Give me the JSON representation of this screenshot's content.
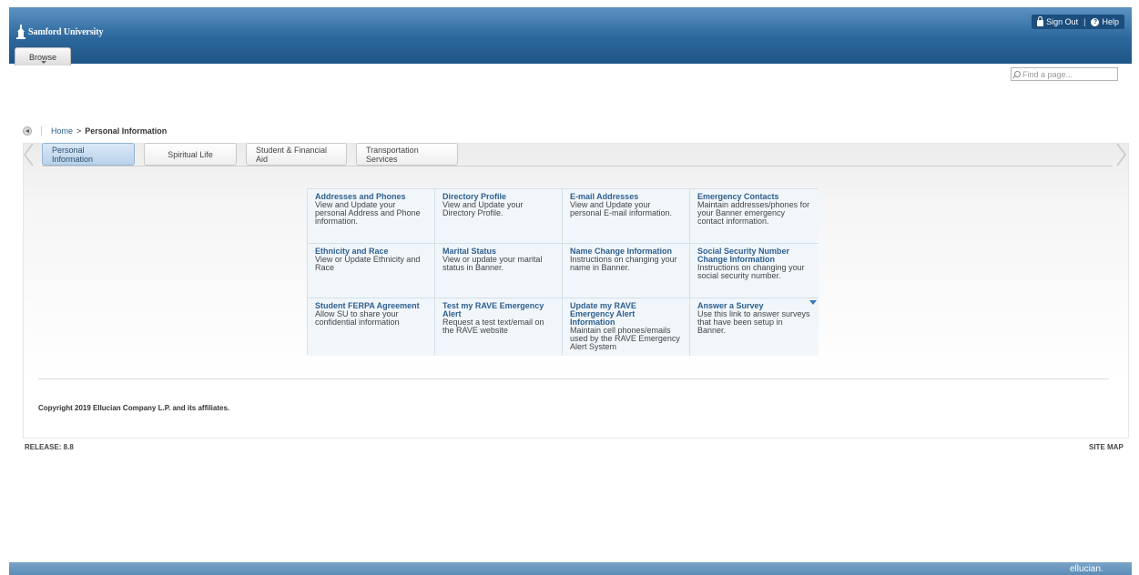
{
  "header": {
    "logo_text": "Samford University",
    "browse_label": "Browse",
    "sign_out_label": "Sign Out",
    "separator": "|",
    "help_label": "Help"
  },
  "search": {
    "placeholder": "Find a page..."
  },
  "breadcrumb": {
    "home": "Home",
    "arrow": ">",
    "current": "Personal Information"
  },
  "tabs": [
    {
      "label": "Personal Information",
      "active": true
    },
    {
      "label": "Spiritual Life",
      "active": false
    },
    {
      "label": "Student & Financial Aid",
      "active": false
    },
    {
      "label": "Transportation Services",
      "active": false
    }
  ],
  "links": [
    {
      "title": "Addresses and Phones",
      "desc": "View and Update your personal Address and Phone information."
    },
    {
      "title": "Directory Profile",
      "desc": "View and Update your Directory Profile."
    },
    {
      "title": "E-mail Addresses",
      "desc": "View and Update your personal E-mail information."
    },
    {
      "title": "Emergency Contacts",
      "desc": "Maintain addresses/phones for your Banner emergency contact information."
    },
    {
      "title": "Ethnicity and Race",
      "desc": "View or Update Ethnicity and Race"
    },
    {
      "title": "Marital Status",
      "desc": "View or update your marital status in Banner."
    },
    {
      "title": "Name Change Information",
      "desc": "Instructions on changing your name in Banner."
    },
    {
      "title": "Social Security Number Change Information",
      "desc": "Instructions on changing your social security number."
    },
    {
      "title": "Student FERPA Agreement",
      "desc": "Allow SU to share your confidential information"
    },
    {
      "title": "Test my RAVE Emergency Alert",
      "desc": "Request a test text/email on the RAVE website"
    },
    {
      "title": "Update my RAVE Emergency Alert Information",
      "desc": "Maintain cell phones/emails used by the RAVE Emergency Alert System"
    },
    {
      "title": "Answer a Survey",
      "desc": "Use this link to answer surveys that have been setup in Banner."
    }
  ],
  "footer": {
    "copyright": "Copyright 2019 Ellucian Company L.P. and its affiliates.",
    "release": "RELEASE: 8.8",
    "site_map": "SITE MAP",
    "brand": "ellucian."
  }
}
